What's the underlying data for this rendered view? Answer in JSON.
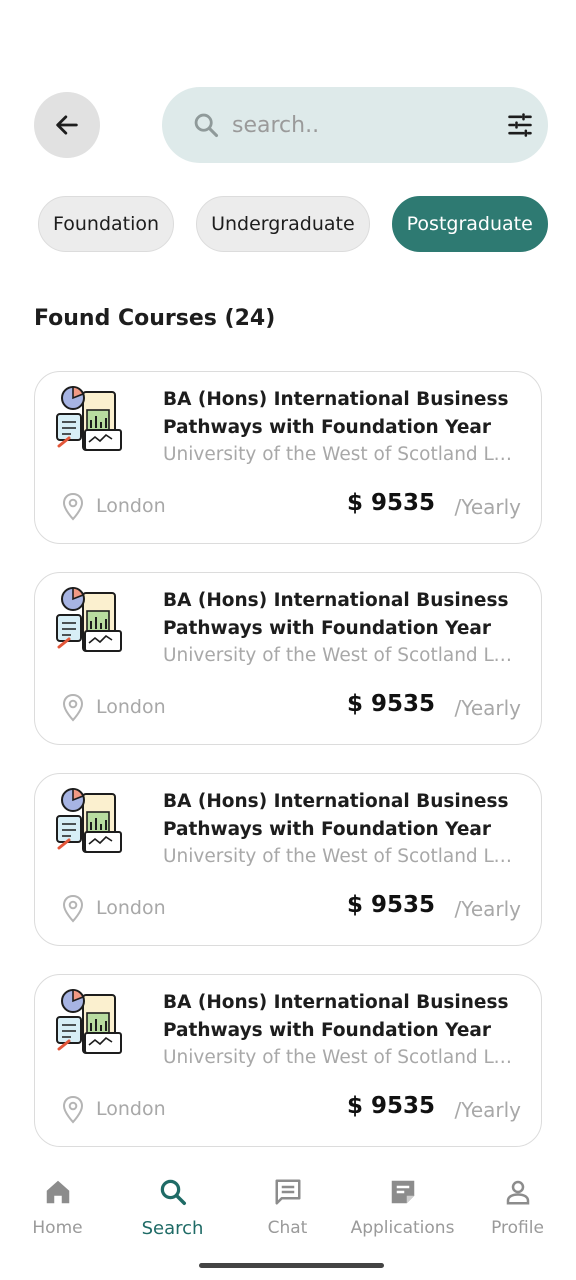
{
  "search": {
    "placeholder": "search..",
    "value": ""
  },
  "filters": [
    {
      "label": "Foundation",
      "active": false
    },
    {
      "label": "Undergraduate",
      "active": false
    },
    {
      "label": "Postgraduate",
      "active": true
    }
  ],
  "results": {
    "title": "Found Courses (24)"
  },
  "courses": [
    {
      "title": "BA (Hons) International Business Pathways with Foundation Year",
      "university": "University of the West of Scotland London",
      "location": "London",
      "price": "$ 9535",
      "period": "/Yearly",
      "icon": "business-analytics-icon"
    },
    {
      "title": "BA (Hons) International Business Pathways with Foundation Year",
      "university": "University of the West of Scotland London",
      "location": "London",
      "price": "$ 9535",
      "period": "/Yearly",
      "icon": "business-analytics-icon"
    },
    {
      "title": "BA (Hons) International Business Pathways with Foundation Year",
      "university": "University of the West of Scotland London",
      "location": "London",
      "price": "$ 9535",
      "period": "/Yearly",
      "icon": "business-analytics-icon"
    },
    {
      "title": "BA (Hons) International Business Pathways with Foundation Year",
      "university": "University of the West of Scotland London",
      "location": "London",
      "price": "$ 9535",
      "period": "/Yearly",
      "icon": "business-analytics-icon"
    }
  ],
  "nav": [
    {
      "label": "Home",
      "icon": "home-icon",
      "active": false
    },
    {
      "label": "Search",
      "icon": "search-icon",
      "active": true
    },
    {
      "label": "Chat",
      "icon": "chat-icon",
      "active": false
    },
    {
      "label": "Applications",
      "icon": "application-icon",
      "active": false
    },
    {
      "label": "Profile",
      "icon": "profile-icon",
      "active": false
    }
  ],
  "colors": {
    "accent": "#2e7a72",
    "search_bg": "#deeaea",
    "chip_bg": "#ececec",
    "muted_text": "#a8a8a8"
  }
}
